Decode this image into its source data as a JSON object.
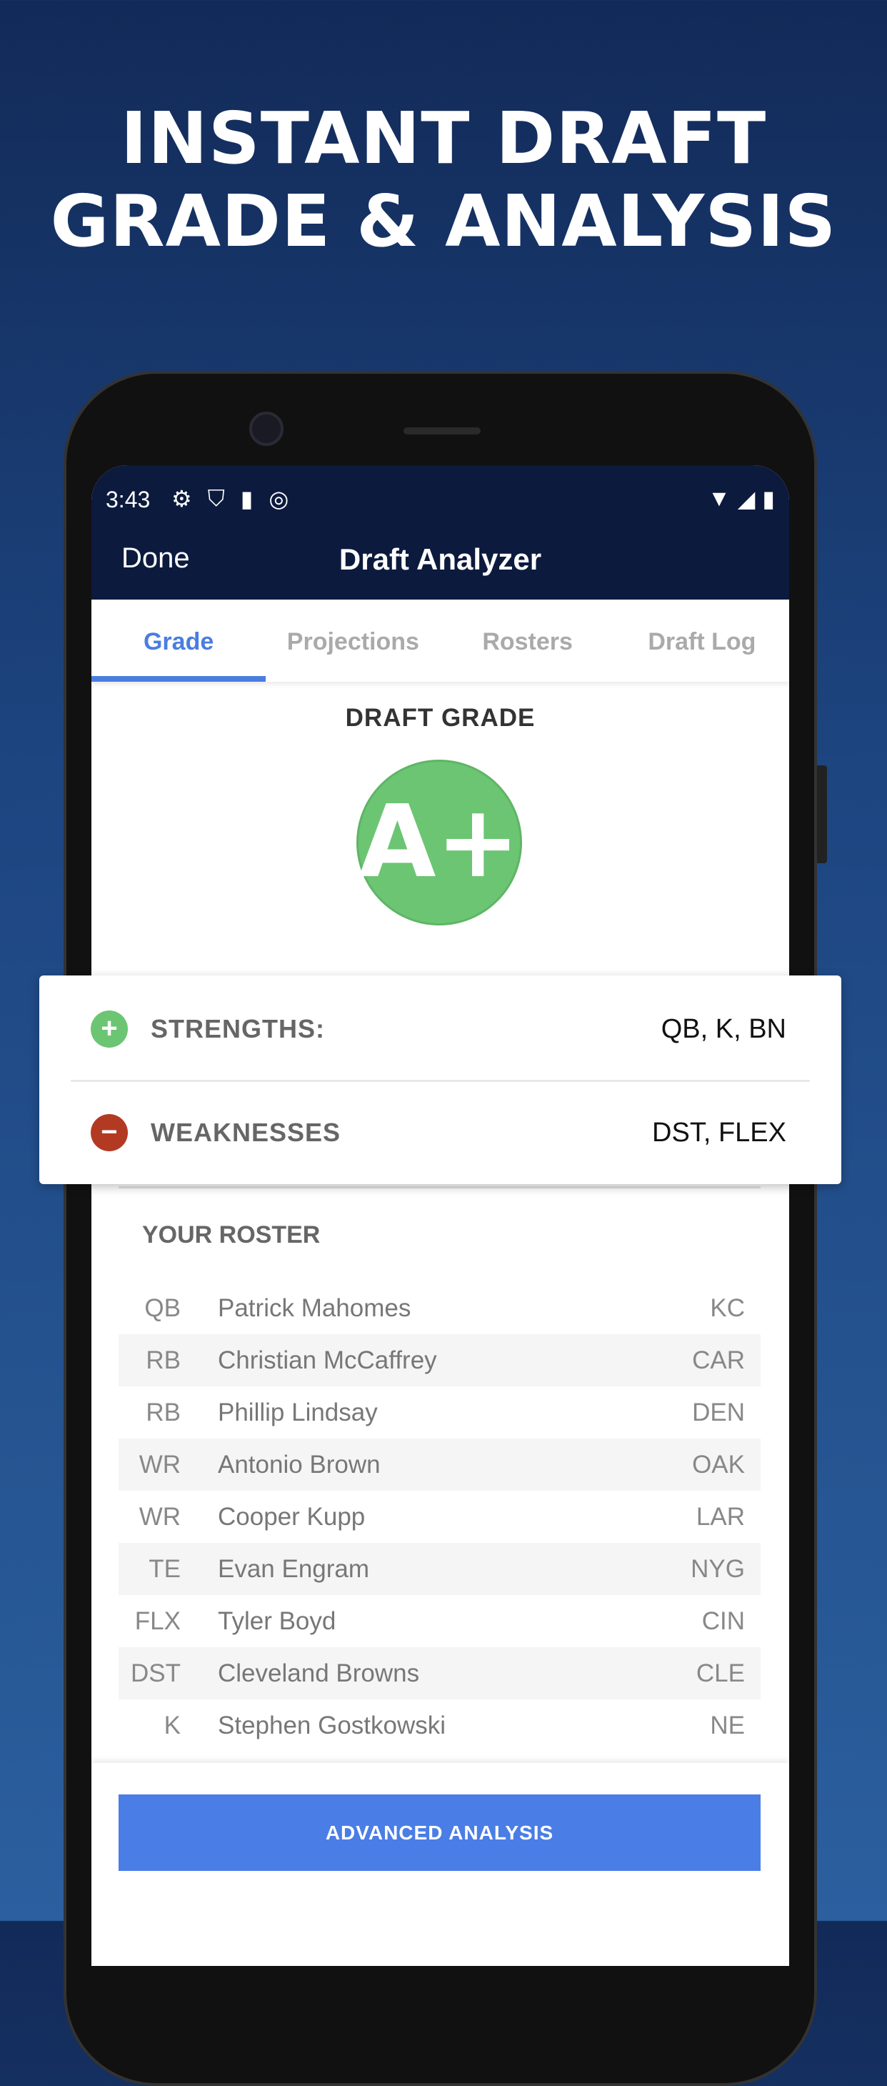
{
  "headline": {
    "line1": "INSTANT DRAFT",
    "line2": "GRADE & ANALYSIS"
  },
  "status_bar": {
    "time": "3:43",
    "icons": [
      "gear-icon",
      "shield-play-icon",
      "sd-card-icon",
      "data-saver-icon"
    ],
    "right_icons": [
      "wifi-icon",
      "signal-icon",
      "battery-icon"
    ]
  },
  "nav": {
    "done_label": "Done",
    "title": "Draft Analyzer"
  },
  "tabs": [
    {
      "label": "Grade",
      "active": true
    },
    {
      "label": "Projections"
    },
    {
      "label": "Rosters"
    },
    {
      "label": "Draft Log"
    }
  ],
  "grade": {
    "label": "DRAFT GRADE",
    "value": "A+",
    "color": "#6cc572"
  },
  "summary": {
    "strengths_label": "STRENGTHS:",
    "strengths_value": "QB, K, BN",
    "strengths_color": "#6cc572",
    "weaknesses_label": "WEAKNESSES",
    "weaknesses_value": "DST, FLEX",
    "weaknesses_color": "#b33a22"
  },
  "roster": {
    "title": "YOUR ROSTER",
    "rows": [
      {
        "pos": "QB",
        "name": "Patrick Mahomes",
        "team": "KC"
      },
      {
        "pos": "RB",
        "name": "Christian McCaffrey",
        "team": "CAR"
      },
      {
        "pos": "RB",
        "name": "Phillip Lindsay",
        "team": "DEN"
      },
      {
        "pos": "WR",
        "name": "Antonio Brown",
        "team": "OAK"
      },
      {
        "pos": "WR",
        "name": "Cooper Kupp",
        "team": "LAR"
      },
      {
        "pos": "TE",
        "name": "Evan Engram",
        "team": "NYG"
      },
      {
        "pos": "FLX",
        "name": "Tyler Boyd",
        "team": "CIN"
      },
      {
        "pos": "DST",
        "name": "Cleveland Browns",
        "team": "CLE"
      },
      {
        "pos": "K",
        "name": "Stephen Gostkowski",
        "team": "NE"
      }
    ]
  },
  "button": {
    "label": "ADVANCED ANALYSIS",
    "color": "#4a7de6"
  }
}
